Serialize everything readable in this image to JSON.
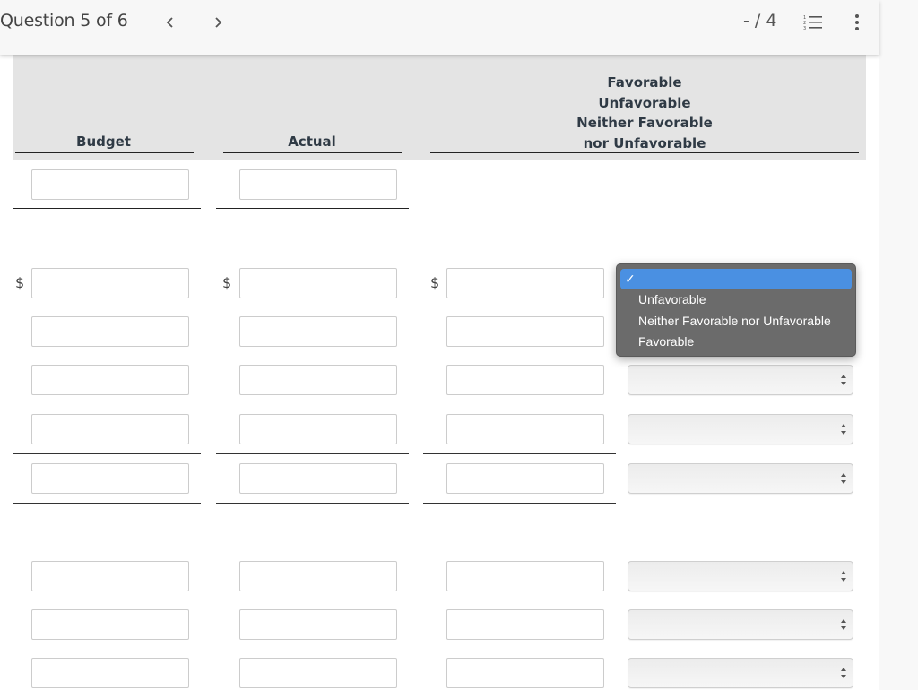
{
  "topbar": {
    "question_label": "Question 5 of 6",
    "prev_icon": "chevron-left-icon",
    "next_icon": "chevron-right-icon",
    "score": "- / 4",
    "list_icon": "numbered-list-icon",
    "more_icon": "more-vertical-icon"
  },
  "table": {
    "headers": {
      "budget": "Budget",
      "actual": "Actual",
      "favorability_lines": [
        "Favorable",
        "Unfavorable",
        "Neither Favorable",
        "nor Unfavorable"
      ]
    },
    "currency_symbol": "$",
    "rows": [
      {
        "budget": "",
        "actual": ""
      },
      {
        "budget": "",
        "actual": "",
        "difference": "",
        "favorability": ""
      },
      {
        "budget": "",
        "actual": "",
        "difference": "",
        "favorability": ""
      },
      {
        "budget": "",
        "actual": "",
        "difference": "",
        "favorability": ""
      },
      {
        "budget": "",
        "actual": "",
        "difference": "",
        "favorability": ""
      },
      {
        "budget": "",
        "actual": "",
        "difference": "",
        "favorability": ""
      },
      {
        "budget": "",
        "actual": "",
        "difference": "",
        "favorability": ""
      },
      {
        "budget": "",
        "actual": "",
        "difference": "",
        "favorability": ""
      },
      {
        "budget": "",
        "actual": "",
        "difference": "",
        "favorability": ""
      }
    ]
  },
  "dropdown_open": {
    "selected_index": 0,
    "check_glyph": "✓",
    "options": [
      "",
      "Unfavorable",
      "Neither Favorable nor Unfavorable",
      "Favorable"
    ]
  },
  "colors": {
    "dropdown_bg": "#6b6b6b",
    "dropdown_highlight": "#4a90e2",
    "header_band": "#e4e4e4"
  }
}
